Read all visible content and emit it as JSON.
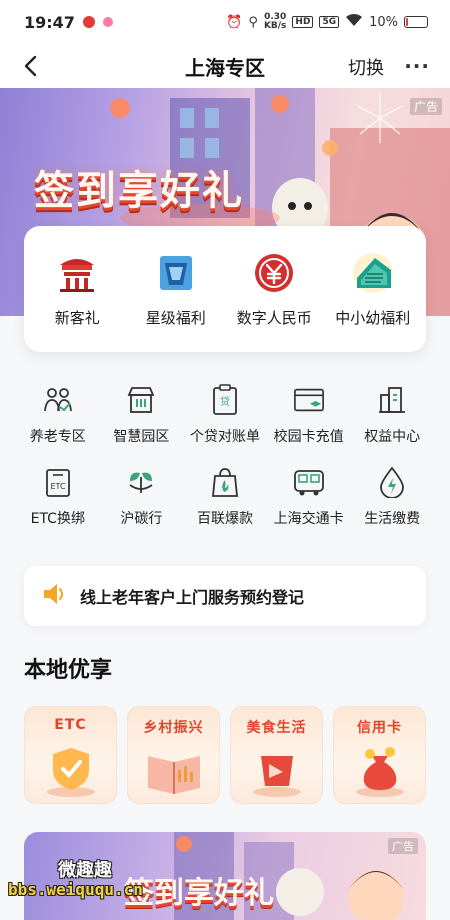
{
  "status_bar": {
    "time": "19:47",
    "net_speed": "0.30",
    "net_unit": "KB/s",
    "hd": "HD",
    "network": "5G",
    "battery": "10%",
    "battery_level": 0.1
  },
  "nav": {
    "title": "上海专区",
    "switch_label": "切换",
    "more_label": "···"
  },
  "banner": {
    "title": "签到享好礼",
    "ad_label": "广告"
  },
  "featured": [
    {
      "label": "新客礼",
      "icon": "gift-pavilion-icon"
    },
    {
      "label": "星级福利",
      "icon": "star-card-icon"
    },
    {
      "label": "数字人民币",
      "icon": "digital-yuan-icon"
    },
    {
      "label": "中小幼福利",
      "icon": "building-icon"
    }
  ],
  "services": [
    {
      "label": "养老专区",
      "icon": "elderly-care-icon"
    },
    {
      "label": "智慧园区",
      "icon": "smart-park-icon"
    },
    {
      "label": "个贷对账单",
      "icon": "loan-statement-icon"
    },
    {
      "label": "校园卡充值",
      "icon": "campus-card-icon"
    },
    {
      "label": "权益中心",
      "icon": "benefits-center-icon"
    },
    {
      "label": "ETC换绑",
      "icon": "etc-icon"
    },
    {
      "label": "沪碳行",
      "icon": "carbon-leaf-icon"
    },
    {
      "label": "百联爆款",
      "icon": "shopping-bag-icon"
    },
    {
      "label": "上海交通卡",
      "icon": "bus-icon"
    },
    {
      "label": "生活缴费",
      "icon": "utility-drop-icon"
    }
  ],
  "notice": {
    "text": "线上老年客户上门服务预约登记",
    "icon": "speaker-icon"
  },
  "local_section": {
    "title": "本地优享",
    "cards": [
      {
        "label": "ETC"
      },
      {
        "label": "乡村振兴"
      },
      {
        "label": "美食生活"
      },
      {
        "label": "信用卡"
      }
    ]
  },
  "banner2": {
    "title": "签到享好礼",
    "ad_label": "广告"
  },
  "watermark": {
    "name": "微趣趣",
    "url": "bbs.weiququ.cn"
  },
  "colors": {
    "accent_red": "#e2452d",
    "icon_gray": "#3a3a3a",
    "icon_green": "#3aa57a"
  }
}
